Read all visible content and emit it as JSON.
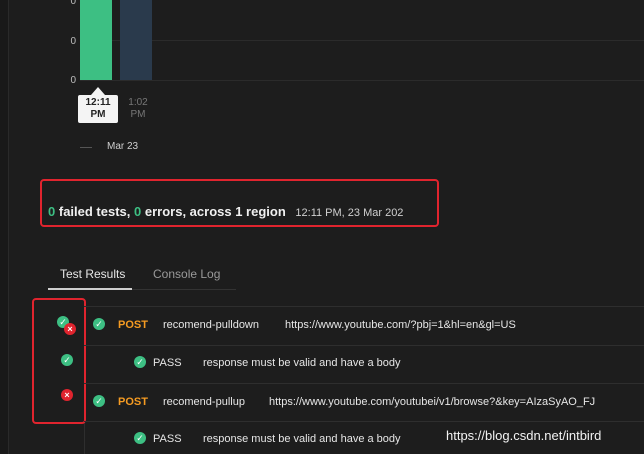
{
  "chart": {
    "y_labels": [
      "0",
      "0",
      "0"
    ],
    "time_labels": [
      {
        "line1": "12:11",
        "line2": "PM"
      },
      {
        "line1": "1:02",
        "line2": "PM"
      }
    ],
    "date_label": "Mar 23"
  },
  "summary": {
    "failed_count": "0",
    "failed_text": "failed tests,",
    "error_count": "0",
    "error_text": "errors, across 1 region",
    "timestamp": "12:11 PM, 23 Mar 202"
  },
  "tabs": [
    {
      "label": "Test Results",
      "active": true
    },
    {
      "label": "Console Log",
      "active": false
    }
  ],
  "results": [
    {
      "method": "POST",
      "name": "recomend-pulldown",
      "url": "https://www.youtube.com/?pbj=1&hl=en&gl=US",
      "test": {
        "status": "PASS",
        "message": "response must be valid and have a body"
      }
    },
    {
      "method": "POST",
      "name": "recomend-pullup",
      "url": "https://www.youtube.com/youtubei/v1/browse?&key=AIzaSyAO_FJ",
      "test": {
        "status": "PASS",
        "message": "response must be valid and have a body"
      }
    }
  ],
  "watermark": "https://blog.csdn.net/intbird",
  "colors": {
    "accent_green": "#3dbf83",
    "error_red": "#e0242e",
    "post_orange": "#f59b22"
  }
}
